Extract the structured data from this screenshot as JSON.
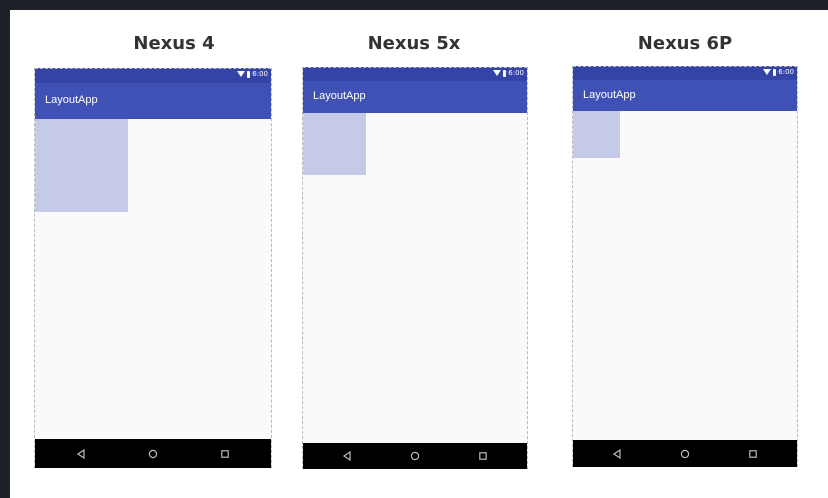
{
  "devices": [
    {
      "name": "Nexus 4",
      "status": {
        "time": "6:00",
        "icons": [
          "wifi-icon",
          "battery-icon"
        ]
      },
      "app_bar": {
        "title": "LayoutApp"
      },
      "nav": [
        "back-icon",
        "home-icon",
        "recents-icon"
      ]
    },
    {
      "name": "Nexus 5x",
      "status": {
        "time": "6:00",
        "icons": [
          "wifi-icon",
          "battery-icon"
        ]
      },
      "app_bar": {
        "title": "LayoutApp"
      },
      "nav": [
        "back-icon",
        "home-icon",
        "recents-icon"
      ]
    },
    {
      "name": "Nexus 6P",
      "status": {
        "time": "6:00",
        "icons": [
          "wifi-icon",
          "battery-icon"
        ]
      },
      "app_bar": {
        "title": "LayoutApp"
      },
      "nav": [
        "back-icon",
        "home-icon",
        "recents-icon"
      ]
    }
  ],
  "colors": {
    "status_bar": "#3444a6",
    "app_bar": "#3f51b5",
    "content_bg": "#fafafa",
    "view_box": "#c5cae9",
    "nav_bar": "#000000"
  }
}
